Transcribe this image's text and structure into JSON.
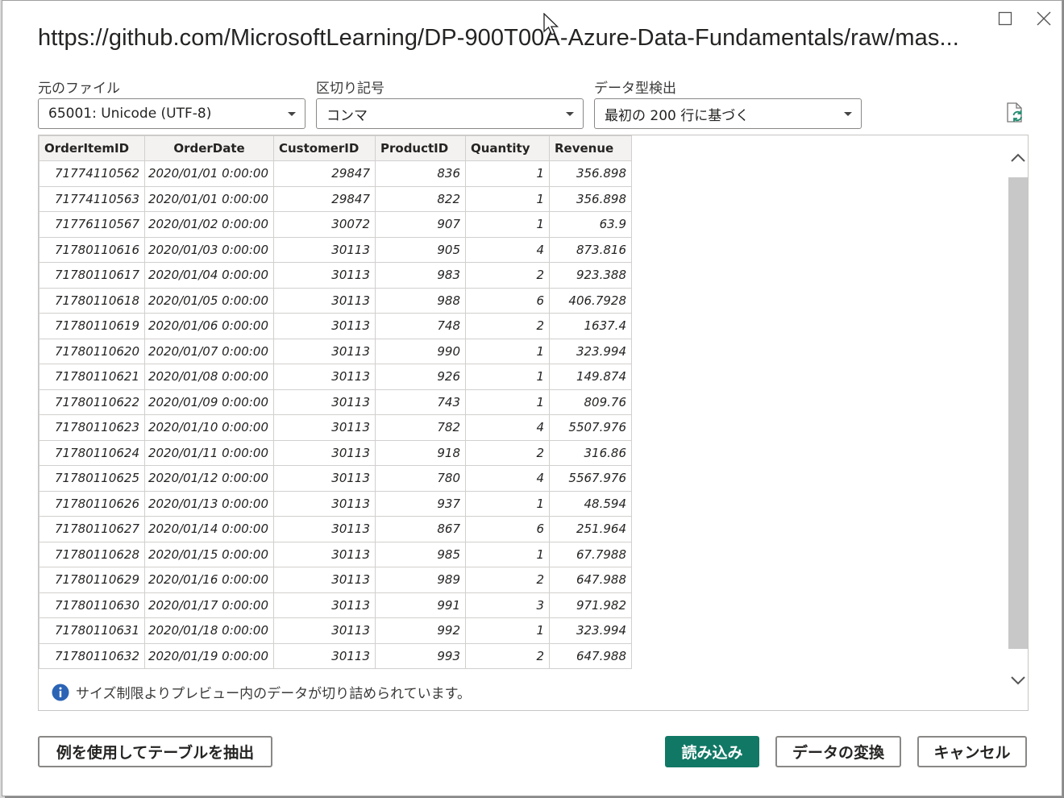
{
  "dialog": {
    "title": "https://github.com/MicrosoftLearning/DP-900T00A-Azure-Data-Fundamentals/raw/mas..."
  },
  "options": {
    "file_origin": {
      "label": "元のファイル",
      "value": "65001: Unicode (UTF-8)"
    },
    "delimiter": {
      "label": "区切り記号",
      "value": "コンマ"
    },
    "type_detection": {
      "label": "データ型検出",
      "value": "最初の 200 行に基づく"
    }
  },
  "table": {
    "columns": [
      "OrderItemID",
      "OrderDate",
      "CustomerID",
      "ProductID",
      "Quantity",
      "Revenue"
    ],
    "rows": [
      [
        "71774110562",
        "2020/01/01 0:00:00",
        "29847",
        "836",
        "1",
        "356.898"
      ],
      [
        "71774110563",
        "2020/01/01 0:00:00",
        "29847",
        "822",
        "1",
        "356.898"
      ],
      [
        "71776110567",
        "2020/01/02 0:00:00",
        "30072",
        "907",
        "1",
        "63.9"
      ],
      [
        "71780110616",
        "2020/01/03 0:00:00",
        "30113",
        "905",
        "4",
        "873.816"
      ],
      [
        "71780110617",
        "2020/01/04 0:00:00",
        "30113",
        "983",
        "2",
        "923.388"
      ],
      [
        "71780110618",
        "2020/01/05 0:00:00",
        "30113",
        "988",
        "6",
        "406.7928"
      ],
      [
        "71780110619",
        "2020/01/06 0:00:00",
        "30113",
        "748",
        "2",
        "1637.4"
      ],
      [
        "71780110620",
        "2020/01/07 0:00:00",
        "30113",
        "990",
        "1",
        "323.994"
      ],
      [
        "71780110621",
        "2020/01/08 0:00:00",
        "30113",
        "926",
        "1",
        "149.874"
      ],
      [
        "71780110622",
        "2020/01/09 0:00:00",
        "30113",
        "743",
        "1",
        "809.76"
      ],
      [
        "71780110623",
        "2020/01/10 0:00:00",
        "30113",
        "782",
        "4",
        "5507.976"
      ],
      [
        "71780110624",
        "2020/01/11 0:00:00",
        "30113",
        "918",
        "2",
        "316.86"
      ],
      [
        "71780110625",
        "2020/01/12 0:00:00",
        "30113",
        "780",
        "4",
        "5567.976"
      ],
      [
        "71780110626",
        "2020/01/13 0:00:00",
        "30113",
        "937",
        "1",
        "48.594"
      ],
      [
        "71780110627",
        "2020/01/14 0:00:00",
        "30113",
        "867",
        "6",
        "251.964"
      ],
      [
        "71780110628",
        "2020/01/15 0:00:00",
        "30113",
        "985",
        "1",
        "67.7988"
      ],
      [
        "71780110629",
        "2020/01/16 0:00:00",
        "30113",
        "989",
        "2",
        "647.988"
      ],
      [
        "71780110630",
        "2020/01/17 0:00:00",
        "30113",
        "991",
        "3",
        "971.982"
      ],
      [
        "71780110631",
        "2020/01/18 0:00:00",
        "30113",
        "992",
        "1",
        "323.994"
      ],
      [
        "71780110632",
        "2020/01/19 0:00:00",
        "30113",
        "993",
        "2",
        "647.988"
      ]
    ]
  },
  "notice": {
    "icon": "info-icon",
    "text": "サイズ制限よりプレビュー内のデータが切り詰められています。"
  },
  "buttons": {
    "extract_table": "例を使用してテーブルを抽出",
    "load": "読み込み",
    "transform": "データの変換",
    "cancel": "キャンセル"
  },
  "colors": {
    "primary": "#117865",
    "info": "#2b64b5",
    "refresh_accent": "#1f8c6e"
  }
}
